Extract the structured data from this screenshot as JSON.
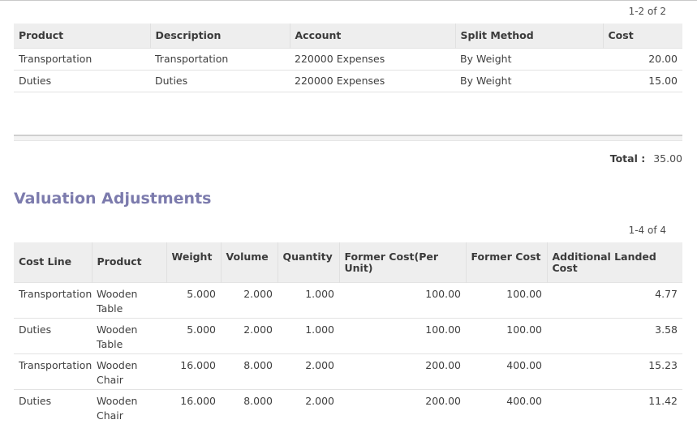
{
  "landed_costs": {
    "pager": "1-2 of 2",
    "columns": [
      "Product",
      "Description",
      "Account",
      "Split Method",
      "Cost"
    ],
    "rows": [
      {
        "product": "Transportation",
        "description": "Transportation",
        "account": "220000 Expenses",
        "split_method": "By Weight",
        "cost": "20.00"
      },
      {
        "product": "Duties",
        "description": "Duties",
        "account": "220000 Expenses",
        "split_method": "By Weight",
        "cost": "15.00"
      }
    ],
    "total_label": "Total :",
    "total_value": "35.00"
  },
  "valuation": {
    "title": "Valuation Adjustments",
    "pager": "1-4 of 4",
    "columns": [
      "Cost Line",
      "Product",
      "Weight",
      "Volume",
      "Quantity",
      "Former Cost(Per Unit)",
      "Former Cost",
      "Additional Landed Cost"
    ],
    "rows": [
      {
        "cost_line": "Transportation",
        "product": "Wooden Table",
        "weight": "5.000",
        "volume": "2.000",
        "quantity": "1.000",
        "former_unit": "100.00",
        "former_cost": "100.00",
        "additional": "4.77"
      },
      {
        "cost_line": "Duties",
        "product": "Wooden Table",
        "weight": "5.000",
        "volume": "2.000",
        "quantity": "1.000",
        "former_unit": "100.00",
        "former_cost": "100.00",
        "additional": "3.58"
      },
      {
        "cost_line": "Transportation",
        "product": "Wooden Chair",
        "weight": "16.000",
        "volume": "8.000",
        "quantity": "2.000",
        "former_unit": "200.00",
        "former_cost": "400.00",
        "additional": "15.23"
      },
      {
        "cost_line": "Duties",
        "product": "Wooden Chair",
        "weight": "16.000",
        "volume": "8.000",
        "quantity": "2.000",
        "former_unit": "200.00",
        "former_cost": "400.00",
        "additional": "11.42"
      }
    ]
  }
}
